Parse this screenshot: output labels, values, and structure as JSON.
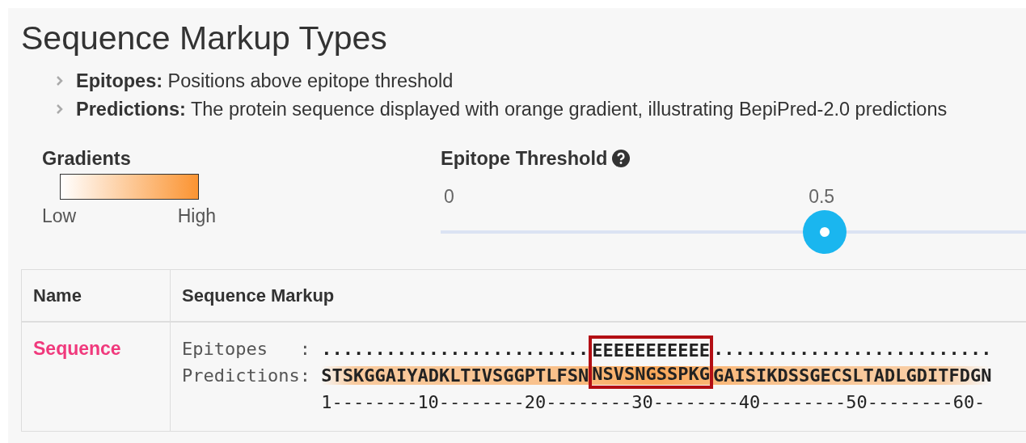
{
  "title": "Sequence Markup Types",
  "legend": [
    {
      "term": "Epitopes:",
      "text": "Positions above epitope threshold"
    },
    {
      "term": "Predictions:",
      "text": "The protein sequence displayed with orange gradient, illustrating BepiPred-2.0 predictions"
    }
  ],
  "gradients": {
    "title": "Gradients",
    "low_label": "Low",
    "high_label": "High"
  },
  "threshold": {
    "title": "Epitope Threshold",
    "min_label": "0",
    "value_label": "0.5",
    "level": 0.5
  },
  "table": {
    "columns": [
      "Name",
      "Sequence Markup"
    ],
    "rows": [
      {
        "name": "Sequence",
        "lines": [
          {
            "kind": "epitopes",
            "label": "Epitopes   : ",
            "segments": [
              {
                "text": ".........................",
                "highlighted": false
              },
              {
                "text": "EEEEEEEEEEE",
                "highlighted": true
              },
              {
                "text": "..........................",
                "highlighted": false
              }
            ]
          },
          {
            "kind": "predictions",
            "label": "Predictions: ",
            "segments": [
              {
                "text": "STSKGGAIYADKLTIVSGGPTLFSN",
                "highlighted": false
              },
              {
                "text": "NSVSNGSSPKG",
                "highlighted": true
              },
              {
                "text": "GAISIKDSSGECSLTADLGDITFDGN",
                "highlighted": false
              }
            ]
          },
          {
            "kind": "ruler",
            "text": "1--------10--------20--------30--------40--------50--------60-"
          }
        ]
      }
    ]
  }
}
